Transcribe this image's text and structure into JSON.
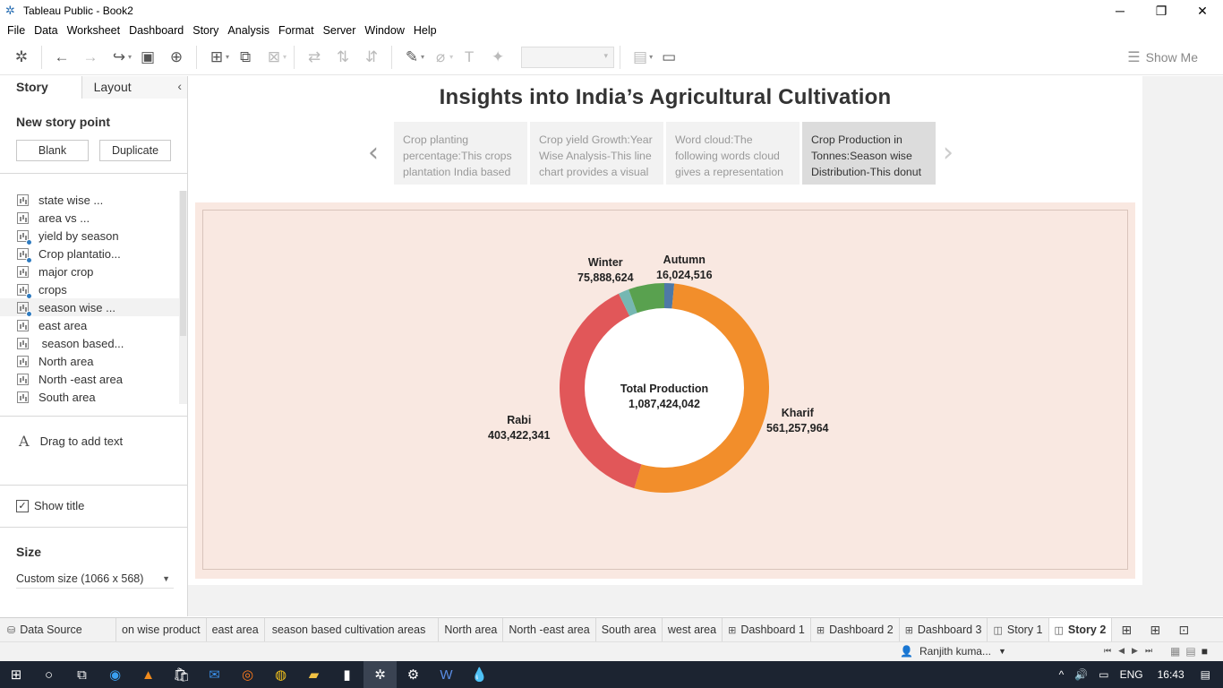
{
  "window": {
    "title": "Tableau Public - Book2"
  },
  "menu": [
    "File",
    "Data",
    "Worksheet",
    "Dashboard",
    "Story",
    "Analysis",
    "Format",
    "Server",
    "Window",
    "Help"
  ],
  "toolbar": {
    "show_me": "Show Me"
  },
  "left_panel": {
    "tabs": {
      "story": "Story",
      "layout": "Layout"
    },
    "new_story_point": "New story point",
    "blank_label": "Blank",
    "duplicate_label": "Duplicate",
    "sheets": [
      "state wise ...",
      "area vs ...",
      "yield by season",
      "Crop plantatio...",
      "major crop",
      "crops",
      "season wise ...",
      "east area",
      " season based...",
      "North area",
      "North -east area",
      "South area"
    ],
    "drag_text": "Drag to add text",
    "show_title": "Show title",
    "size_title": "Size",
    "size_value": "Custom size (1066 x 568)"
  },
  "story": {
    "title": "Insights into India’s Agricultural Cultivation",
    "points": [
      {
        "text": "Crop planting percentage:This crops plantation India based"
      },
      {
        "text": "Crop yield Growth:Year Wise Analysis-This line chart provides a visual"
      },
      {
        "text": "Word cloud:The following words cloud gives a representation"
      },
      {
        "text": "Crop Production in Tonnes:Season wise Distribution-This donut"
      }
    ]
  },
  "chart_data": {
    "type": "pie",
    "categories": [
      "Autumn",
      "Kharif",
      "Rabi",
      "Winter"
    ],
    "values": [
      16024516,
      561257964,
      403422341,
      75888624
    ],
    "labels": [
      "16,024,516",
      "561,257,964",
      "403,422,341",
      "75,888,624"
    ],
    "colors": [
      "#4e79a7",
      "#f28e2b",
      "#e15759",
      "#76b7b2",
      "#59a14f"
    ],
    "center_title": "Total Production",
    "center_value": "1,087,424,042",
    "legend": "none"
  },
  "sheet_tabs": {
    "data_source": "Data Source",
    "tabs": [
      "on wise product",
      "east area",
      "season based cultivation areas",
      "North area",
      "North -east area",
      "South area",
      "west area"
    ],
    "dashboards": [
      "Dashboard 1",
      "Dashboard 2",
      "Dashboard 3"
    ],
    "stories": [
      "Story 1",
      "Story 2"
    ]
  },
  "status": {
    "user": "Ranjith kuma..."
  },
  "taskbar": {
    "lang": "ENG",
    "time": "16:43"
  }
}
